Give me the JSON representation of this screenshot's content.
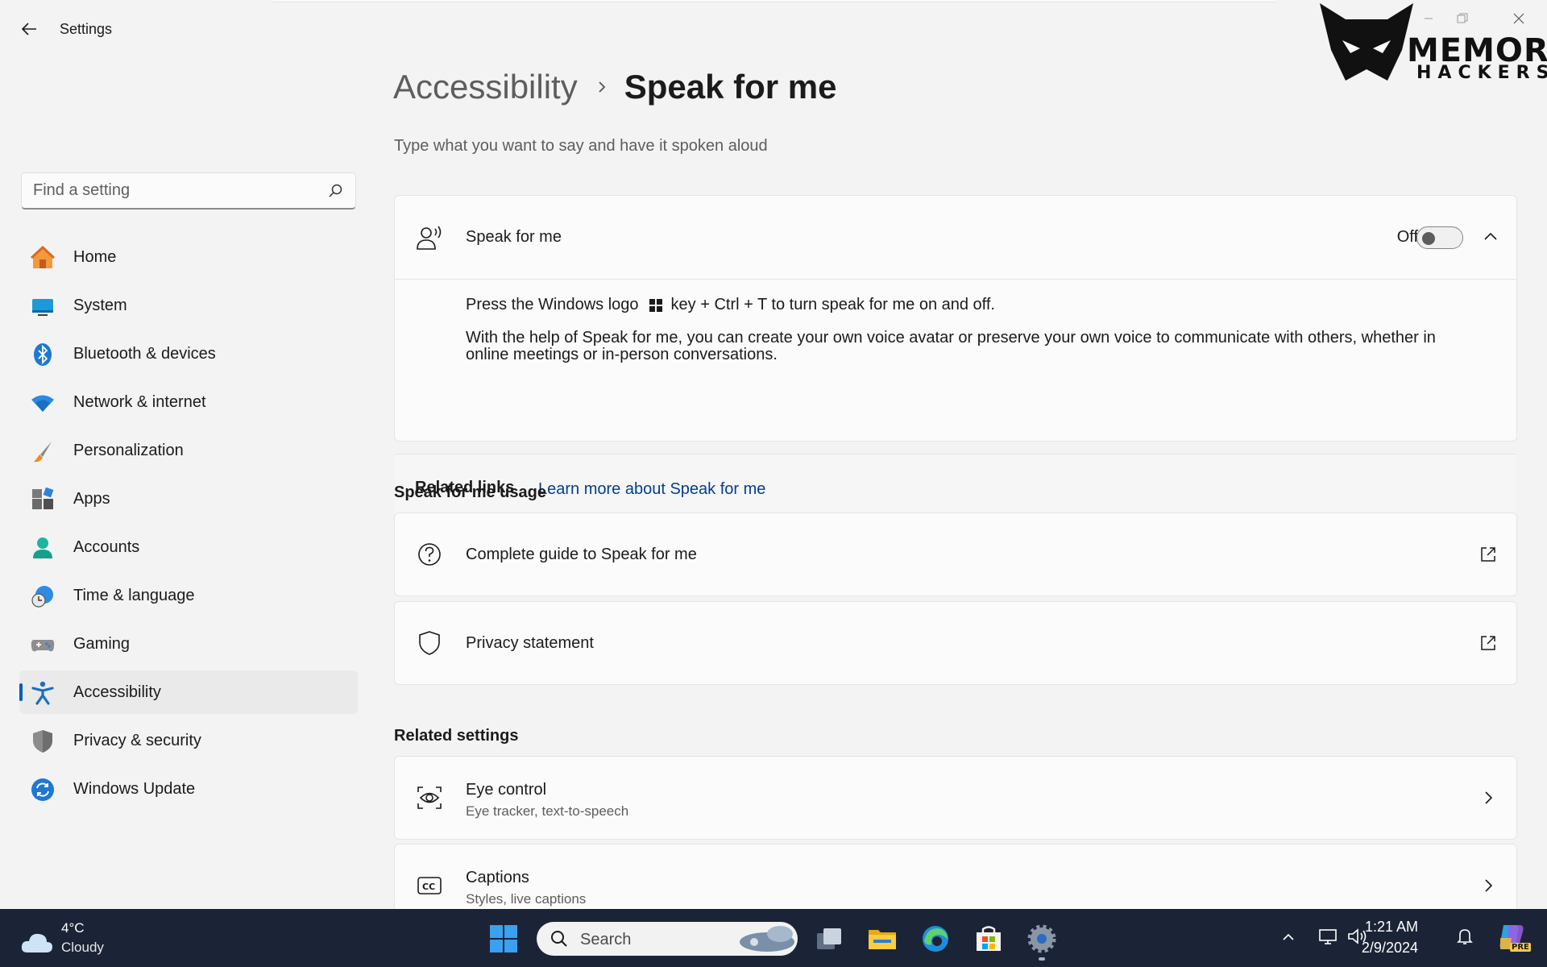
{
  "window": {
    "app_title": "Settings"
  },
  "watermark": {
    "line1": "MEMORY",
    "line2": "HACKERS"
  },
  "sidebar": {
    "search_placeholder": "Find a setting",
    "items": [
      {
        "label": "Home",
        "icon": "home-icon",
        "active": false
      },
      {
        "label": "System",
        "icon": "system-icon",
        "active": false
      },
      {
        "label": "Bluetooth & devices",
        "icon": "bluetooth-icon",
        "active": false
      },
      {
        "label": "Network & internet",
        "icon": "wifi-icon",
        "active": false
      },
      {
        "label": "Personalization",
        "icon": "brush-icon",
        "active": false
      },
      {
        "label": "Apps",
        "icon": "apps-icon",
        "active": false
      },
      {
        "label": "Accounts",
        "icon": "account-icon",
        "active": false
      },
      {
        "label": "Time & language",
        "icon": "globe-clock-icon",
        "active": false
      },
      {
        "label": "Gaming",
        "icon": "gamepad-icon",
        "active": false
      },
      {
        "label": "Accessibility",
        "icon": "accessibility-icon",
        "active": true
      },
      {
        "label": "Privacy & security",
        "icon": "shield-icon",
        "active": false
      },
      {
        "label": "Windows Update",
        "icon": "update-icon",
        "active": false
      }
    ]
  },
  "main": {
    "breadcrumb_parent": "Accessibility",
    "breadcrumb_current": "Speak for me",
    "subtitle": "Type what you want to say and have it spoken aloud",
    "expander": {
      "title": "Speak for me",
      "toggle_state": "Off",
      "shortcut_prefix": "Press the Windows logo",
      "shortcut_suffix": "key + Ctrl + T to turn speak for me on and off.",
      "description": "With the help of Speak for me, you can create your own voice avatar or preserve your own voice to communicate with others, whether in online meetings or in-person conversations.",
      "related_links_label": "Related links",
      "related_link": "Learn more about Speak for me"
    },
    "usage_section": {
      "title": "Speak for me usage",
      "items": [
        {
          "label": "Complete guide to Speak for me"
        },
        {
          "label": "Privacy statement"
        }
      ]
    },
    "related_section": {
      "title": "Related settings",
      "items": [
        {
          "label": "Eye control",
          "desc": "Eye tracker, text-to-speech"
        },
        {
          "label": "Captions",
          "desc": "Styles, live captions"
        }
      ]
    }
  },
  "taskbar": {
    "weather_temp": "4°C",
    "weather_condition": "Cloudy",
    "search_placeholder": "Search",
    "time": "1:21 AM",
    "date": "2/9/2024",
    "copilot_badge": "PRE"
  },
  "colors": {
    "accent": "#005fb8",
    "link": "#003e92",
    "taskbar": "#1b2436"
  }
}
